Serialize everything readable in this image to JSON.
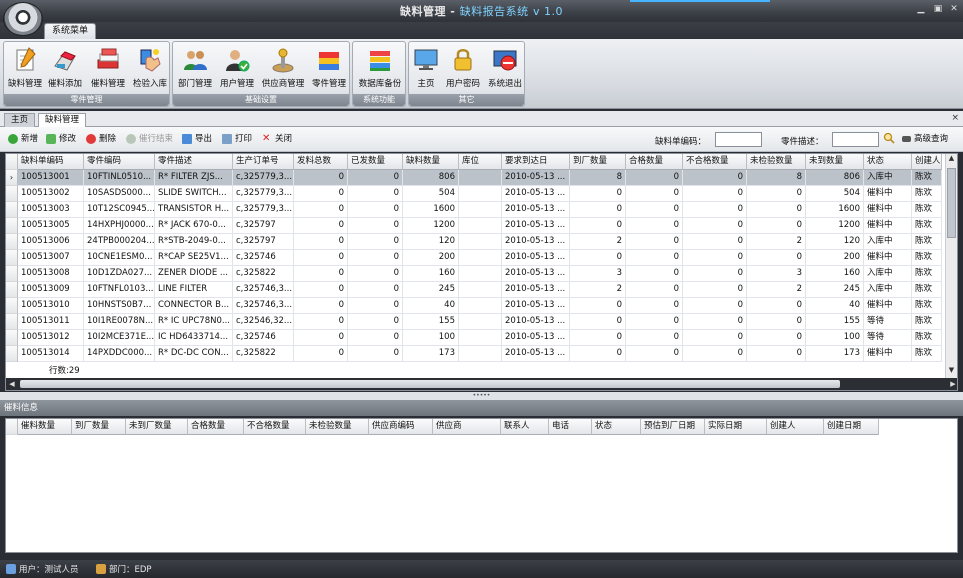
{
  "window": {
    "title_main": "缺料管理 - ",
    "title_sub": "缺料报告系统",
    "version": "v 1.0"
  },
  "ribbon": {
    "tab": "系统菜单",
    "groups": [
      {
        "caption": "零件管理",
        "buttons": [
          "缺料管理",
          "催料添加",
          "催料管理",
          "检验入库"
        ]
      },
      {
        "caption": "基础设置",
        "buttons": [
          "部门管理",
          "用户管理",
          "供应商管理",
          "零件管理"
        ]
      },
      {
        "caption": "系统功能",
        "buttons": [
          "数据库备份"
        ]
      },
      {
        "caption": "其它",
        "buttons": [
          "主页",
          "用户密码",
          "系统退出"
        ]
      }
    ]
  },
  "doc_tabs": [
    "主页",
    "缺料管理"
  ],
  "toolbar": {
    "add": "新增",
    "edit": "修改",
    "delete": "删除",
    "finish": "催行结束",
    "export": "导出",
    "print": "打印",
    "close": "关闭",
    "code_label": "缺料单编码：",
    "code_value": "",
    "desc_label": "零件描述：",
    "desc_value": "",
    "advanced": "高级查询"
  },
  "grid": {
    "columns": [
      "缺料单编码",
      "零件编码",
      "零件描述",
      "生产订单号",
      "发料总数",
      "已发数量",
      "缺料数量",
      "库位",
      "要求到达日",
      "到厂数量",
      "合格数量",
      "不合格数量",
      "未检验数量",
      "未到数量",
      "状态",
      "创建人"
    ],
    "rows": [
      [
        "100513001",
        "10FTINL0510...",
        "R* FILTER ZJS...",
        "c,325779,3...",
        "0",
        "0",
        "806",
        "",
        "2010-05-13 ...",
        "8",
        "0",
        "0",
        "8",
        "806",
        "入库中",
        "陈欢"
      ],
      [
        "100513002",
        "10SASDS000...",
        "SLIDE SWITCH...",
        "c,325779,3...",
        "0",
        "0",
        "504",
        "",
        "2010-05-13 ...",
        "0",
        "0",
        "0",
        "0",
        "504",
        "催料中",
        "陈欢"
      ],
      [
        "100513003",
        "10T12SC0945...",
        "TRANSISTOR H...",
        "c,325779,3...",
        "0",
        "0",
        "1600",
        "",
        "2010-05-13 ...",
        "0",
        "0",
        "0",
        "0",
        "1600",
        "催料中",
        "陈欢"
      ],
      [
        "100513005",
        "14HXPHJ0000...",
        "R* JACK 670-0...",
        "c,325797",
        "0",
        "0",
        "1200",
        "",
        "2010-05-13 ...",
        "0",
        "0",
        "0",
        "0",
        "1200",
        "催料中",
        "陈欢"
      ],
      [
        "100513006",
        "24TPB000204...",
        "R*STB-2049-0...",
        "c,325797",
        "0",
        "0",
        "120",
        "",
        "2010-05-13 ...",
        "2",
        "0",
        "0",
        "2",
        "120",
        "入库中",
        "陈欢"
      ],
      [
        "100513007",
        "10CNE1ESM0...",
        "R*CAP SE25V1...",
        "c,325746",
        "0",
        "0",
        "200",
        "",
        "2010-05-13 ...",
        "0",
        "0",
        "0",
        "0",
        "200",
        "催料中",
        "陈欢"
      ],
      [
        "100513008",
        "10D1ZDA027...",
        "ZENER DIODE ...",
        "c,325822",
        "0",
        "0",
        "160",
        "",
        "2010-05-13 ...",
        "3",
        "0",
        "0",
        "3",
        "160",
        "入库中",
        "陈欢"
      ],
      [
        "100513009",
        "10FTNFL0103...",
        "LINE FILTER",
        "c,325746,3...",
        "0",
        "0",
        "245",
        "",
        "2010-05-13 ...",
        "2",
        "0",
        "0",
        "2",
        "245",
        "入库中",
        "陈欢"
      ],
      [
        "100513010",
        "10HNSTS0B7...",
        "CONNECTOR B...",
        "c,325746,3...",
        "0",
        "0",
        "40",
        "",
        "2010-05-13 ...",
        "0",
        "0",
        "0",
        "0",
        "40",
        "催料中",
        "陈欢"
      ],
      [
        "100513011",
        "10I1RE0078N...",
        "R* IC UPC78N0...",
        "c,32546,32...",
        "0",
        "0",
        "155",
        "",
        "2010-05-13 ...",
        "0",
        "0",
        "0",
        "0",
        "155",
        "等待",
        "陈欢"
      ],
      [
        "100513012",
        "10I2MCE371E...",
        "IC HD6433714...",
        "c,325746",
        "0",
        "0",
        "100",
        "",
        "2010-05-13 ...",
        "0",
        "0",
        "0",
        "0",
        "100",
        "等待",
        "陈欢"
      ],
      [
        "100513014",
        "14PXDDC000...",
        "R* DC-DC CON...",
        "c,325822",
        "0",
        "0",
        "173",
        "",
        "2010-05-13 ...",
        "0",
        "0",
        "0",
        "0",
        "173",
        "催料中",
        "陈欢"
      ]
    ],
    "row_count": "行数:29"
  },
  "detail": {
    "title": "催料信息",
    "columns": [
      "催料数量",
      "到厂数量",
      "未到厂数量",
      "合格数量",
      "不合格数量",
      "未检验数量",
      "供应商编码",
      "供应商",
      "联系人",
      "电话",
      "状态",
      "预估到厂日期",
      "实际日期",
      "创建人",
      "创建日期"
    ]
  },
  "status": {
    "user": "用户：测试人员",
    "dept": "部门：EDP"
  },
  "colors": {
    "accent": "#46b4ff",
    "selected_row": "#bcc2c9"
  }
}
